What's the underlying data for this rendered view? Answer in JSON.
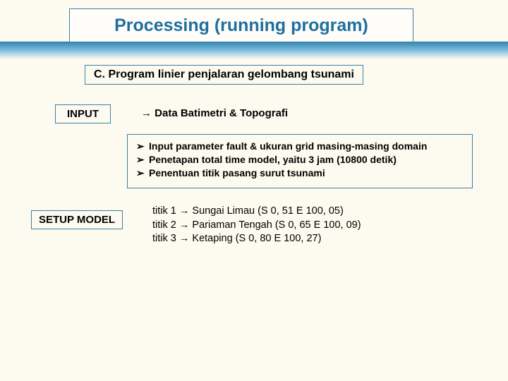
{
  "title": "Processing (running program)",
  "subtitle": "C. Program linier penjalaran gelombang tsunami",
  "input": {
    "label": "INPUT",
    "arrow": "→",
    "text": "Data Batimetri & Topografi"
  },
  "bullets": {
    "marker": "➢",
    "items": [
      "Input parameter fault & ukuran grid masing-masing domain",
      "Penetapan total time model, yaitu 3 jam (10800 detik)",
      "Penentuan titik pasang surut tsunami"
    ]
  },
  "setup": {
    "label": "SETUP MODEL",
    "arrow": "→",
    "points": [
      {
        "prefix": "titik 1",
        "name": "Sungai Limau",
        "coords": "(S 0, 51 E 100, 05)"
      },
      {
        "prefix": "titik 2",
        "name": "Pariaman Tengah",
        "coords": "(S 0, 65 E 100, 09)"
      },
      {
        "prefix": "titik 3",
        "name": "Ketaping",
        "coords": "(S 0, 80 E 100, 27)"
      }
    ]
  }
}
